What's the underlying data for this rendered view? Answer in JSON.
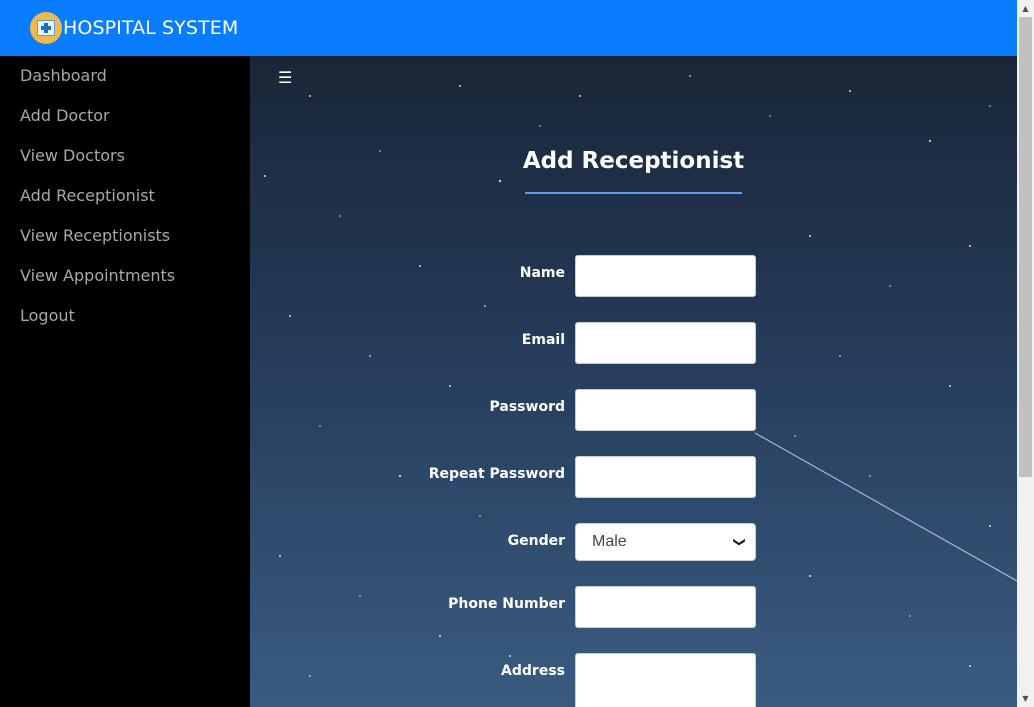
{
  "header": {
    "title": "HOSPITAL SYSTEM",
    "logo_icon": "hospital-logo-icon"
  },
  "sidebar": {
    "items": [
      {
        "label": "Dashboard"
      },
      {
        "label": "Add Doctor"
      },
      {
        "label": "View Doctors"
      },
      {
        "label": "Add Receptionist"
      },
      {
        "label": "View Receptionists"
      },
      {
        "label": "View Appointments"
      },
      {
        "label": "Logout"
      }
    ]
  },
  "main": {
    "menu_icon": "hamburger-menu-icon",
    "title": "Add Receptionist",
    "fields": {
      "name": {
        "label": "Name",
        "value": ""
      },
      "email": {
        "label": "Email",
        "value": ""
      },
      "password": {
        "label": "Password",
        "value": ""
      },
      "repeat_password": {
        "label": "Repeat Password",
        "value": ""
      },
      "gender": {
        "label": "Gender",
        "value": "Male"
      },
      "phone": {
        "label": "Phone Number",
        "value": ""
      },
      "address": {
        "label": "Address",
        "value": ""
      }
    }
  },
  "colors": {
    "topbar": "#0a7cff",
    "sidebar": "#000000",
    "sidebar_text": "#a8a8a8",
    "title_underline": "#5aa0e6"
  }
}
